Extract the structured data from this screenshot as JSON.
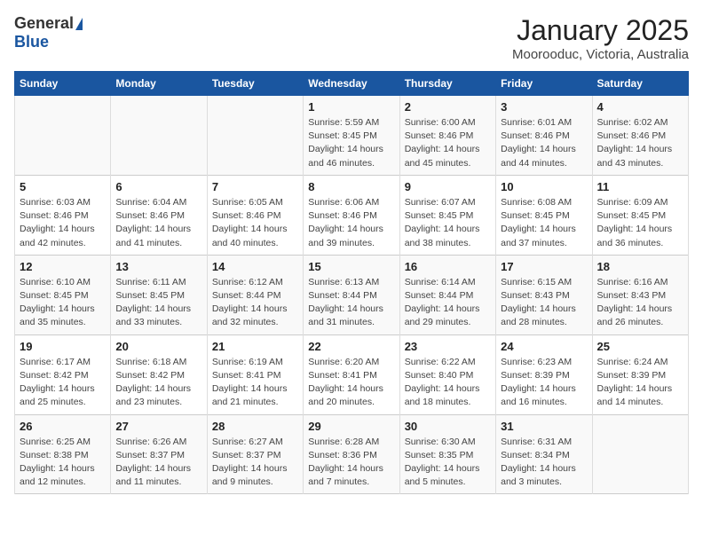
{
  "logo": {
    "general": "General",
    "blue": "Blue"
  },
  "title": "January 2025",
  "subtitle": "Moorooduc, Victoria, Australia",
  "days_of_week": [
    "Sunday",
    "Monday",
    "Tuesday",
    "Wednesday",
    "Thursday",
    "Friday",
    "Saturday"
  ],
  "weeks": [
    [
      {
        "day": "",
        "info": ""
      },
      {
        "day": "",
        "info": ""
      },
      {
        "day": "",
        "info": ""
      },
      {
        "day": "1",
        "info": "Sunrise: 5:59 AM\nSunset: 8:45 PM\nDaylight: 14 hours and 46 minutes."
      },
      {
        "day": "2",
        "info": "Sunrise: 6:00 AM\nSunset: 8:46 PM\nDaylight: 14 hours and 45 minutes."
      },
      {
        "day": "3",
        "info": "Sunrise: 6:01 AM\nSunset: 8:46 PM\nDaylight: 14 hours and 44 minutes."
      },
      {
        "day": "4",
        "info": "Sunrise: 6:02 AM\nSunset: 8:46 PM\nDaylight: 14 hours and 43 minutes."
      }
    ],
    [
      {
        "day": "5",
        "info": "Sunrise: 6:03 AM\nSunset: 8:46 PM\nDaylight: 14 hours and 42 minutes."
      },
      {
        "day": "6",
        "info": "Sunrise: 6:04 AM\nSunset: 8:46 PM\nDaylight: 14 hours and 41 minutes."
      },
      {
        "day": "7",
        "info": "Sunrise: 6:05 AM\nSunset: 8:46 PM\nDaylight: 14 hours and 40 minutes."
      },
      {
        "day": "8",
        "info": "Sunrise: 6:06 AM\nSunset: 8:46 PM\nDaylight: 14 hours and 39 minutes."
      },
      {
        "day": "9",
        "info": "Sunrise: 6:07 AM\nSunset: 8:45 PM\nDaylight: 14 hours and 38 minutes."
      },
      {
        "day": "10",
        "info": "Sunrise: 6:08 AM\nSunset: 8:45 PM\nDaylight: 14 hours and 37 minutes."
      },
      {
        "day": "11",
        "info": "Sunrise: 6:09 AM\nSunset: 8:45 PM\nDaylight: 14 hours and 36 minutes."
      }
    ],
    [
      {
        "day": "12",
        "info": "Sunrise: 6:10 AM\nSunset: 8:45 PM\nDaylight: 14 hours and 35 minutes."
      },
      {
        "day": "13",
        "info": "Sunrise: 6:11 AM\nSunset: 8:45 PM\nDaylight: 14 hours and 33 minutes."
      },
      {
        "day": "14",
        "info": "Sunrise: 6:12 AM\nSunset: 8:44 PM\nDaylight: 14 hours and 32 minutes."
      },
      {
        "day": "15",
        "info": "Sunrise: 6:13 AM\nSunset: 8:44 PM\nDaylight: 14 hours and 31 minutes."
      },
      {
        "day": "16",
        "info": "Sunrise: 6:14 AM\nSunset: 8:44 PM\nDaylight: 14 hours and 29 minutes."
      },
      {
        "day": "17",
        "info": "Sunrise: 6:15 AM\nSunset: 8:43 PM\nDaylight: 14 hours and 28 minutes."
      },
      {
        "day": "18",
        "info": "Sunrise: 6:16 AM\nSunset: 8:43 PM\nDaylight: 14 hours and 26 minutes."
      }
    ],
    [
      {
        "day": "19",
        "info": "Sunrise: 6:17 AM\nSunset: 8:42 PM\nDaylight: 14 hours and 25 minutes."
      },
      {
        "day": "20",
        "info": "Sunrise: 6:18 AM\nSunset: 8:42 PM\nDaylight: 14 hours and 23 minutes."
      },
      {
        "day": "21",
        "info": "Sunrise: 6:19 AM\nSunset: 8:41 PM\nDaylight: 14 hours and 21 minutes."
      },
      {
        "day": "22",
        "info": "Sunrise: 6:20 AM\nSunset: 8:41 PM\nDaylight: 14 hours and 20 minutes."
      },
      {
        "day": "23",
        "info": "Sunrise: 6:22 AM\nSunset: 8:40 PM\nDaylight: 14 hours and 18 minutes."
      },
      {
        "day": "24",
        "info": "Sunrise: 6:23 AM\nSunset: 8:39 PM\nDaylight: 14 hours and 16 minutes."
      },
      {
        "day": "25",
        "info": "Sunrise: 6:24 AM\nSunset: 8:39 PM\nDaylight: 14 hours and 14 minutes."
      }
    ],
    [
      {
        "day": "26",
        "info": "Sunrise: 6:25 AM\nSunset: 8:38 PM\nDaylight: 14 hours and 12 minutes."
      },
      {
        "day": "27",
        "info": "Sunrise: 6:26 AM\nSunset: 8:37 PM\nDaylight: 14 hours and 11 minutes."
      },
      {
        "day": "28",
        "info": "Sunrise: 6:27 AM\nSunset: 8:37 PM\nDaylight: 14 hours and 9 minutes."
      },
      {
        "day": "29",
        "info": "Sunrise: 6:28 AM\nSunset: 8:36 PM\nDaylight: 14 hours and 7 minutes."
      },
      {
        "day": "30",
        "info": "Sunrise: 6:30 AM\nSunset: 8:35 PM\nDaylight: 14 hours and 5 minutes."
      },
      {
        "day": "31",
        "info": "Sunrise: 6:31 AM\nSunset: 8:34 PM\nDaylight: 14 hours and 3 minutes."
      },
      {
        "day": "",
        "info": ""
      }
    ]
  ]
}
